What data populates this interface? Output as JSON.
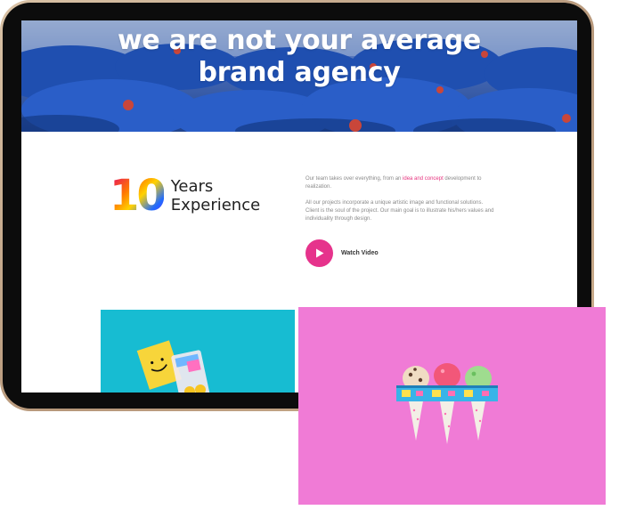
{
  "hero": {
    "title_line1": "we are not your average",
    "title_line2": "brand agency"
  },
  "experience": {
    "number": "10",
    "label_line1": "Years",
    "label_line2": "Experience"
  },
  "about": {
    "para1_before": "Our team takes over everything, from an ",
    "para1_highlight": "idea and concept",
    "para1_after": " development to realization.",
    "para2": "All our projects incorporate a unique artistic image and functional solutions. Client is the soul of the project. Our main goal is to illustrate his/hers values and individuality through design."
  },
  "video": {
    "label": "Watch Video",
    "icon": "play-icon"
  },
  "colors": {
    "accent_pink": "#e6338c",
    "teal_card": "#17bcd2",
    "pink_card": "#f07bd6",
    "tablet_frame": "#c8a98a"
  }
}
